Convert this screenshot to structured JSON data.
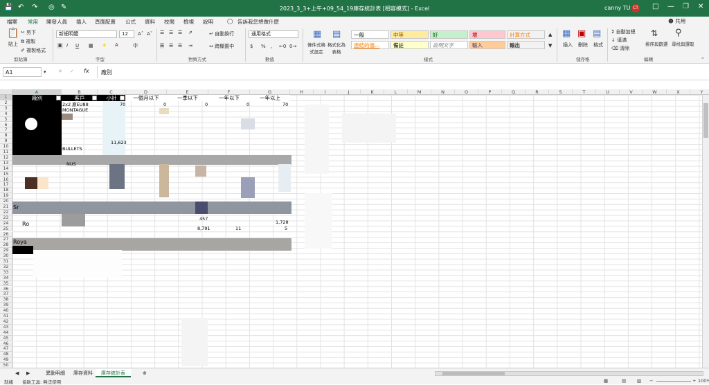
{
  "title_bar": {
    "doc_title": "2023_3_3+上午+09_54_19庫存統計表 [相容模式] - Excel",
    "user": "canny TU",
    "user_initials": "CT",
    "accent": "#217346"
  },
  "tabs": [
    "檔案",
    "常用",
    "開發人員",
    "插入",
    "頁面配置",
    "公式",
    "資料",
    "校閱",
    "檢視",
    "說明"
  ],
  "active_tab": "常用",
  "tell_me": "告訴我您想做什麼",
  "share": "共用",
  "ribbon": {
    "clipboard": {
      "label": "剪貼簿",
      "paste": "貼上",
      "cut": "剪下",
      "copy": "複製",
      "format_painter": "複製格式"
    },
    "font": {
      "label": "字型",
      "font_name": "新細明體",
      "font_size": "12",
      "bold": "B",
      "italic": "I",
      "underline": "U"
    },
    "alignment": {
      "label": "對齊方式",
      "wrap": "自動換行",
      "merge": "跨欄置中"
    },
    "number": {
      "label": "數值",
      "format": "通用格式",
      "currency": "$",
      "percent": "%"
    },
    "styles": {
      "label": "樣式",
      "conditional": "條件式格式設定",
      "as_table": "格式化為表格",
      "items": [
        {
          "text": "一般",
          "bg": "#ffffff",
          "fg": "#000000"
        },
        {
          "text": "中等",
          "bg": "#ffeb9c",
          "fg": "#9c5700"
        },
        {
          "text": "好",
          "bg": "#c6efce",
          "fg": "#006100"
        },
        {
          "text": "壞",
          "bg": "#ffc7ce",
          "fg": "#9c0006"
        },
        {
          "text": "計算方式",
          "bg": "#f2f2f2",
          "fg": "#fa7d00"
        },
        {
          "text": "連結的儲...",
          "bg": "#ffffff",
          "fg": "#fa7d00"
        },
        {
          "text": "備註",
          "bg": "#ffffcc",
          "fg": "#000000"
        },
        {
          "text": "說明文字",
          "bg": "#ffffff",
          "fg": "#7f7f7f"
        },
        {
          "text": "輸入",
          "bg": "#ffcc99",
          "fg": "#3f3f76"
        },
        {
          "text": "輸出",
          "bg": "#f2f2f2",
          "fg": "#3f3f3f"
        }
      ]
    },
    "cells": {
      "label": "儲存格",
      "insert": "插入",
      "delete": "刪除",
      "format": "格式"
    },
    "editing": {
      "label": "編輯",
      "autosum": "自動加總",
      "fill": "填滿",
      "clear": "清除",
      "sort": "排序與篩選",
      "find": "尋找與選取"
    }
  },
  "formula_bar": {
    "name_box": "A1",
    "fx": "fx",
    "content": "廠別"
  },
  "columns": [
    "A",
    "B",
    "C",
    "D",
    "E",
    "F",
    "G",
    "H",
    "I",
    "J",
    "K",
    "L",
    "M",
    "N",
    "O",
    "P",
    "Q",
    "R",
    "S",
    "T",
    "U",
    "V",
    "W",
    "X",
    "Y"
  ],
  "rows": [
    "1",
    "2",
    "3",
    "4",
    "5",
    "6",
    "7",
    "8",
    "9",
    "10",
    "11",
    "12",
    "13",
    "14",
    "15",
    "16",
    "17",
    "18",
    "19",
    "20",
    "21",
    "22",
    "23",
    "24",
    "25",
    "26",
    "27",
    "28",
    "29",
    "30",
    "31",
    "32",
    "33",
    "34",
    "35",
    "36",
    "37",
    "38",
    "39",
    "40",
    "41",
    "42",
    "43",
    "44",
    "45",
    "46",
    "47",
    "48",
    "49",
    "50"
  ],
  "headers": [
    "廠別",
    "客戶",
    "小計",
    "一個月以下",
    "一季以下",
    "一年以下",
    "一年以上"
  ],
  "cell_text": {
    "b2": "2x2 原EU88",
    "b3": "MONTAGUE",
    "c2": "70",
    "d2": "0",
    "e2": "0",
    "f2": "0",
    "g2": "70",
    "c8": "11,623",
    "b9": "BULLETS",
    "b11": "NUS",
    "a18": "Sr",
    "a20": "Ro",
    "e20": "457",
    "e21": "8,791",
    "f21": "11",
    "g20": "1,728",
    "g21": "5",
    "a23": "Roya"
  },
  "sheets": [
    "異動明細",
    "庫存資料",
    "庫存統計表"
  ],
  "active_sheet": "庫存統計表",
  "status": {
    "mode": "就緒",
    "accessibility": "協助工具: 無法使用",
    "zoom": "100%"
  }
}
